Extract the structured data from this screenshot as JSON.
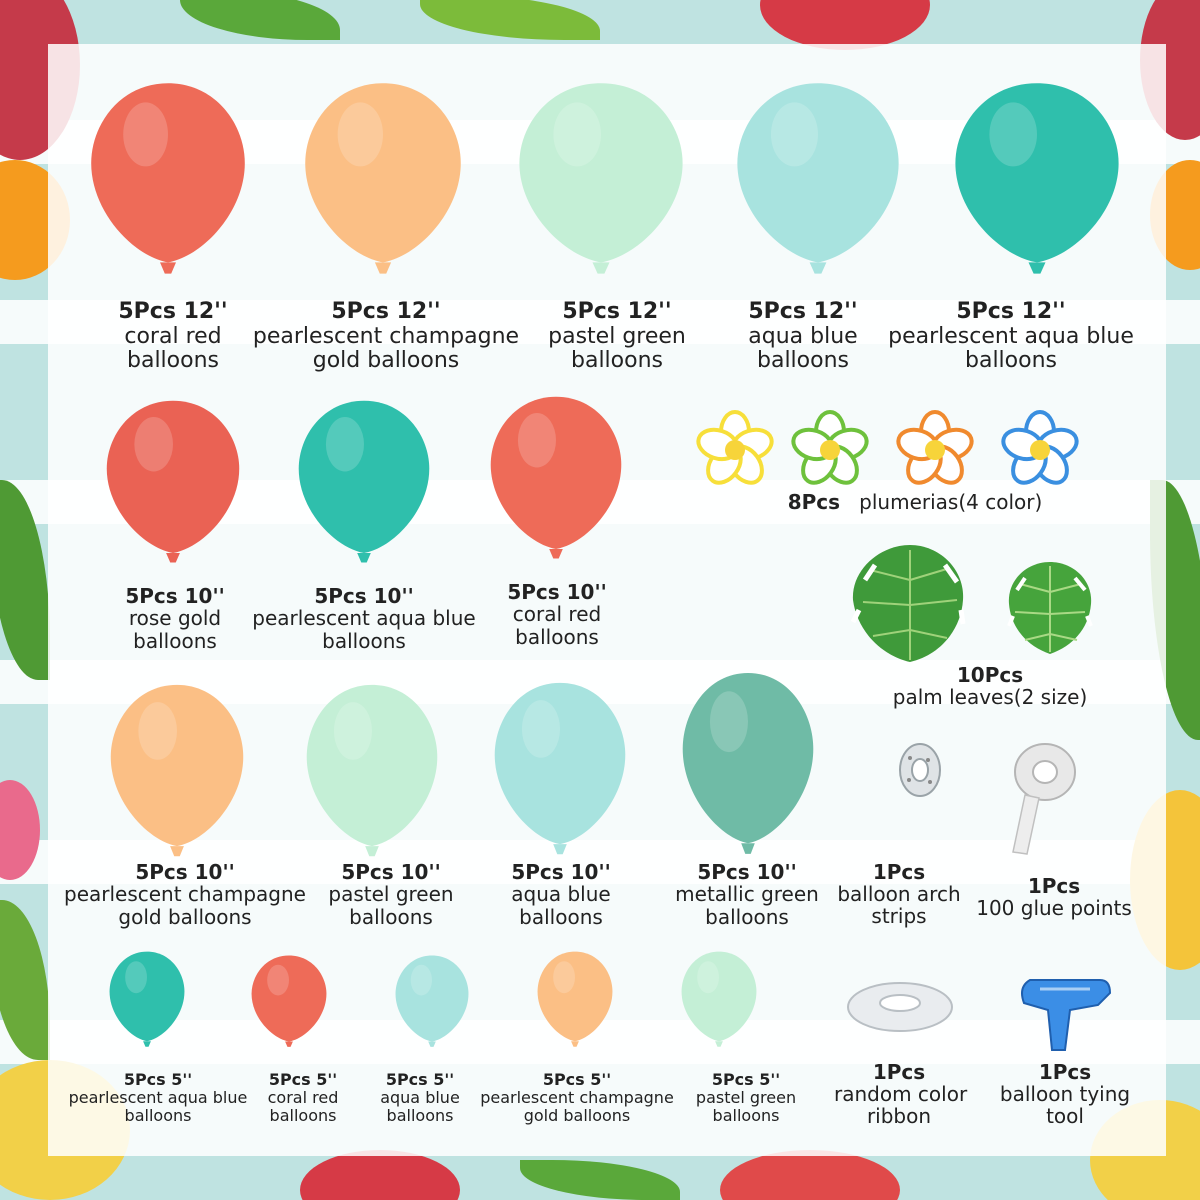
{
  "colors": {
    "coral_red": "#ee6b58",
    "rose_gold": "#ea6254",
    "champagne_gold": "#fbbf85",
    "pastel_green": "#bdeed3",
    "aqua_blue": "#a8e3df",
    "pearl_aqua_blue": "#2fbfac",
    "metallic_green": "#6fbba6",
    "background_teal": "#bfe3e1"
  },
  "row1": [
    {
      "qty": "5Pcs 12''",
      "line1": "coral red",
      "line2": "balloons",
      "color": "#ee6b58"
    },
    {
      "qty": "5Pcs 12''",
      "line1": "pearlescent champagne",
      "line2": "gold balloons",
      "color": "#fbbf85"
    },
    {
      "qty": "5Pcs 12''",
      "line1": "pastel green",
      "line2": "balloons",
      "color": "#c4efd6"
    },
    {
      "qty": "5Pcs 12''",
      "line1": "aqua blue",
      "line2": "balloons",
      "color": "#a8e3df"
    },
    {
      "qty": "5Pcs 12''",
      "line1": "pearlescent aqua blue",
      "line2": "balloons",
      "color": "#2fbfac"
    }
  ],
  "row2": [
    {
      "qty": "5Pcs 10''",
      "line1": "rose gold",
      "line2": "balloons",
      "color": "#ea6254"
    },
    {
      "qty": "5Pcs 10''",
      "line1": "pearlescent aqua blue",
      "line2": "balloons",
      "color": "#2fbfac"
    },
    {
      "qty": "5Pcs 10''",
      "line1": "coral red",
      "line2": "balloons",
      "color": "#ee6b58"
    }
  ],
  "row3": [
    {
      "qty": "5Pcs 10''",
      "line1": "pearlescent champagne",
      "line2": "gold balloons",
      "color": "#fbbf85"
    },
    {
      "qty": "5Pcs 10''",
      "line1": "pastel green",
      "line2": "balloons",
      "color": "#c4efd6"
    },
    {
      "qty": "5Pcs 10''",
      "line1": "aqua blue",
      "line2": "balloons",
      "color": "#a8e3df"
    },
    {
      "qty": "5Pcs 10''",
      "line1": "metallic green",
      "line2": "balloons",
      "color": "#6fbba6"
    }
  ],
  "row4": [
    {
      "qty": "5Pcs 5''",
      "line1": "pearlescent aqua blue",
      "line2": "balloons",
      "color": "#2fbfac"
    },
    {
      "qty": "5Pcs 5''",
      "line1": "coral red",
      "line2": "balloons",
      "color": "#ee6b58"
    },
    {
      "qty": "5Pcs 5''",
      "line1": "aqua blue",
      "line2": "balloons",
      "color": "#a8e3df"
    },
    {
      "qty": "5Pcs 5''",
      "line1": "pearlescent champagne",
      "line2": "gold balloons",
      "color": "#fbbf85"
    },
    {
      "qty": "5Pcs 5''",
      "line1": "pastel green",
      "line2": "balloons",
      "color": "#c4efd6"
    }
  ],
  "accessories": {
    "plumerias": {
      "qty": "8Pcs",
      "name": "plumerias(4 color)",
      "petal_colors": [
        "#f7df3a",
        "#6ec13c",
        "#f08a2e",
        "#3a8fe0"
      ]
    },
    "palm_leaves": {
      "qty": "10Pcs",
      "name": "palm leaves(2 size)"
    },
    "arch_strip": {
      "qty": "1Pcs",
      "line1": "balloon arch",
      "line2": "strips"
    },
    "glue": {
      "qty": "1Pcs",
      "line1": "100 glue points"
    },
    "ribbon": {
      "qty": "1Pcs",
      "line1": "random color",
      "line2": "ribbon"
    },
    "tying_tool": {
      "qty": "1Pcs",
      "line1": "balloon tying",
      "line2": "tool"
    }
  }
}
